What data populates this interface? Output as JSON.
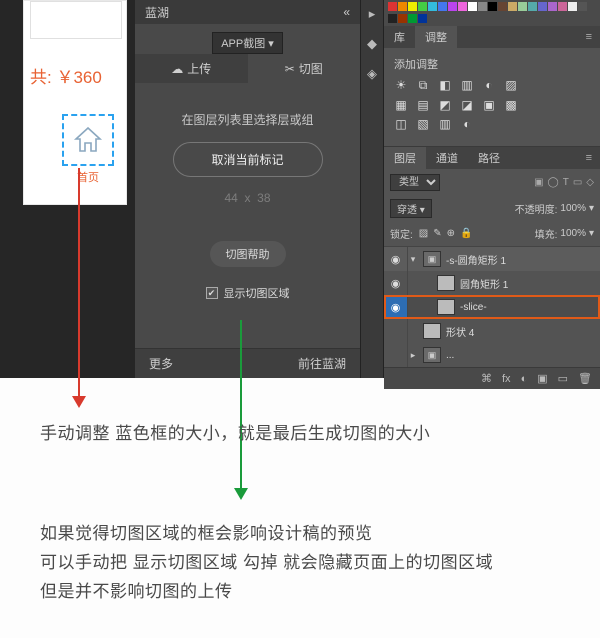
{
  "canvas": {
    "price_text": "共: ￥360",
    "icon_caption": "首页"
  },
  "lanhu": {
    "brand": "蓝湖",
    "header_collapse": "«",
    "title_button": "APP截图",
    "tabs": {
      "upload": "上传",
      "slice": "切图"
    },
    "hint": "在图层列表里选择层或组",
    "cancel_button": "取消当前标记",
    "dims": {
      "w": "44",
      "sep": "x",
      "h": "38"
    },
    "help_button": "切图帮助",
    "show_slice_label": "显示切图区域",
    "footer": {
      "more": "更多",
      "goto": "前往蓝湖"
    }
  },
  "right": {
    "tabs": {
      "library": "库",
      "adjust": "调整",
      "menu": "≡"
    },
    "adjust_title": "添加调整",
    "adj_icons_row1": [
      "☀",
      "⧉",
      "◧",
      "▥",
      "◐",
      "▨"
    ],
    "adj_icons_row2": [
      "▦",
      "▤",
      "◩",
      "◪",
      "▣",
      "▩"
    ],
    "adj_icons_row3": [
      "◫",
      "▧",
      "▥",
      "◐"
    ],
    "layers_tabs": {
      "layers": "图层",
      "channels": "通道",
      "paths": "路径",
      "menu": "≡"
    },
    "layer_controls": {
      "kind": "类型",
      "glyphs": [
        "▣",
        "◯",
        "T",
        "▭",
        "◇"
      ]
    },
    "opacity": {
      "blend": "穿透",
      "label": "不透明度:",
      "val": "100%"
    },
    "lock": {
      "label": "锁定:",
      "glyphs": [
        "▨",
        "✎",
        "⊕",
        "🔒"
      ],
      "fill_label": "填充:",
      "fill_val": "100%"
    },
    "layers": [
      {
        "eye": "◉",
        "indent": 0,
        "caret": "▾",
        "thumb": "folder",
        "name": "-s-圆角矩形 1",
        "group": true
      },
      {
        "eye": "◉",
        "indent": 1,
        "caret": "",
        "thumb": "shape",
        "name": "圆角矩形 1"
      },
      {
        "eye": "◉",
        "indent": 1,
        "caret": "",
        "thumb": "shape",
        "name": "-slice-",
        "selected": true
      },
      {
        "eye": "",
        "indent": 0,
        "caret": "",
        "thumb": "shape",
        "name": "形状 4"
      },
      {
        "eye": "",
        "indent": 0,
        "caret": "▸",
        "thumb": "folder",
        "name": "..."
      }
    ],
    "layer_footer_glyphs": [
      "⌘",
      "fx",
      "◐",
      "▣",
      "▭",
      "🗑"
    ]
  },
  "captions": {
    "c1": "手动调整 蓝色框的大小，就是最后生成切图的大小",
    "c2a": "如果觉得切图区域的框会影响设计稿的预览",
    "c2b": "可以手动把 显示切图区域 勾掉 就会隐藏页面上的切图区域",
    "c2c": "但是并不影响切图的上传"
  },
  "swatches": [
    "#d33",
    "#e80",
    "#ee0",
    "#4c4",
    "#3bd",
    "#47e",
    "#b4e",
    "#e6d",
    "#fff",
    "#888",
    "#000",
    "#643",
    "#ca6",
    "#9c9",
    "#5aa",
    "#66c",
    "#a6c",
    "#c69",
    "#eee",
    "#555",
    "#222",
    "#930",
    "#093",
    "#039"
  ]
}
